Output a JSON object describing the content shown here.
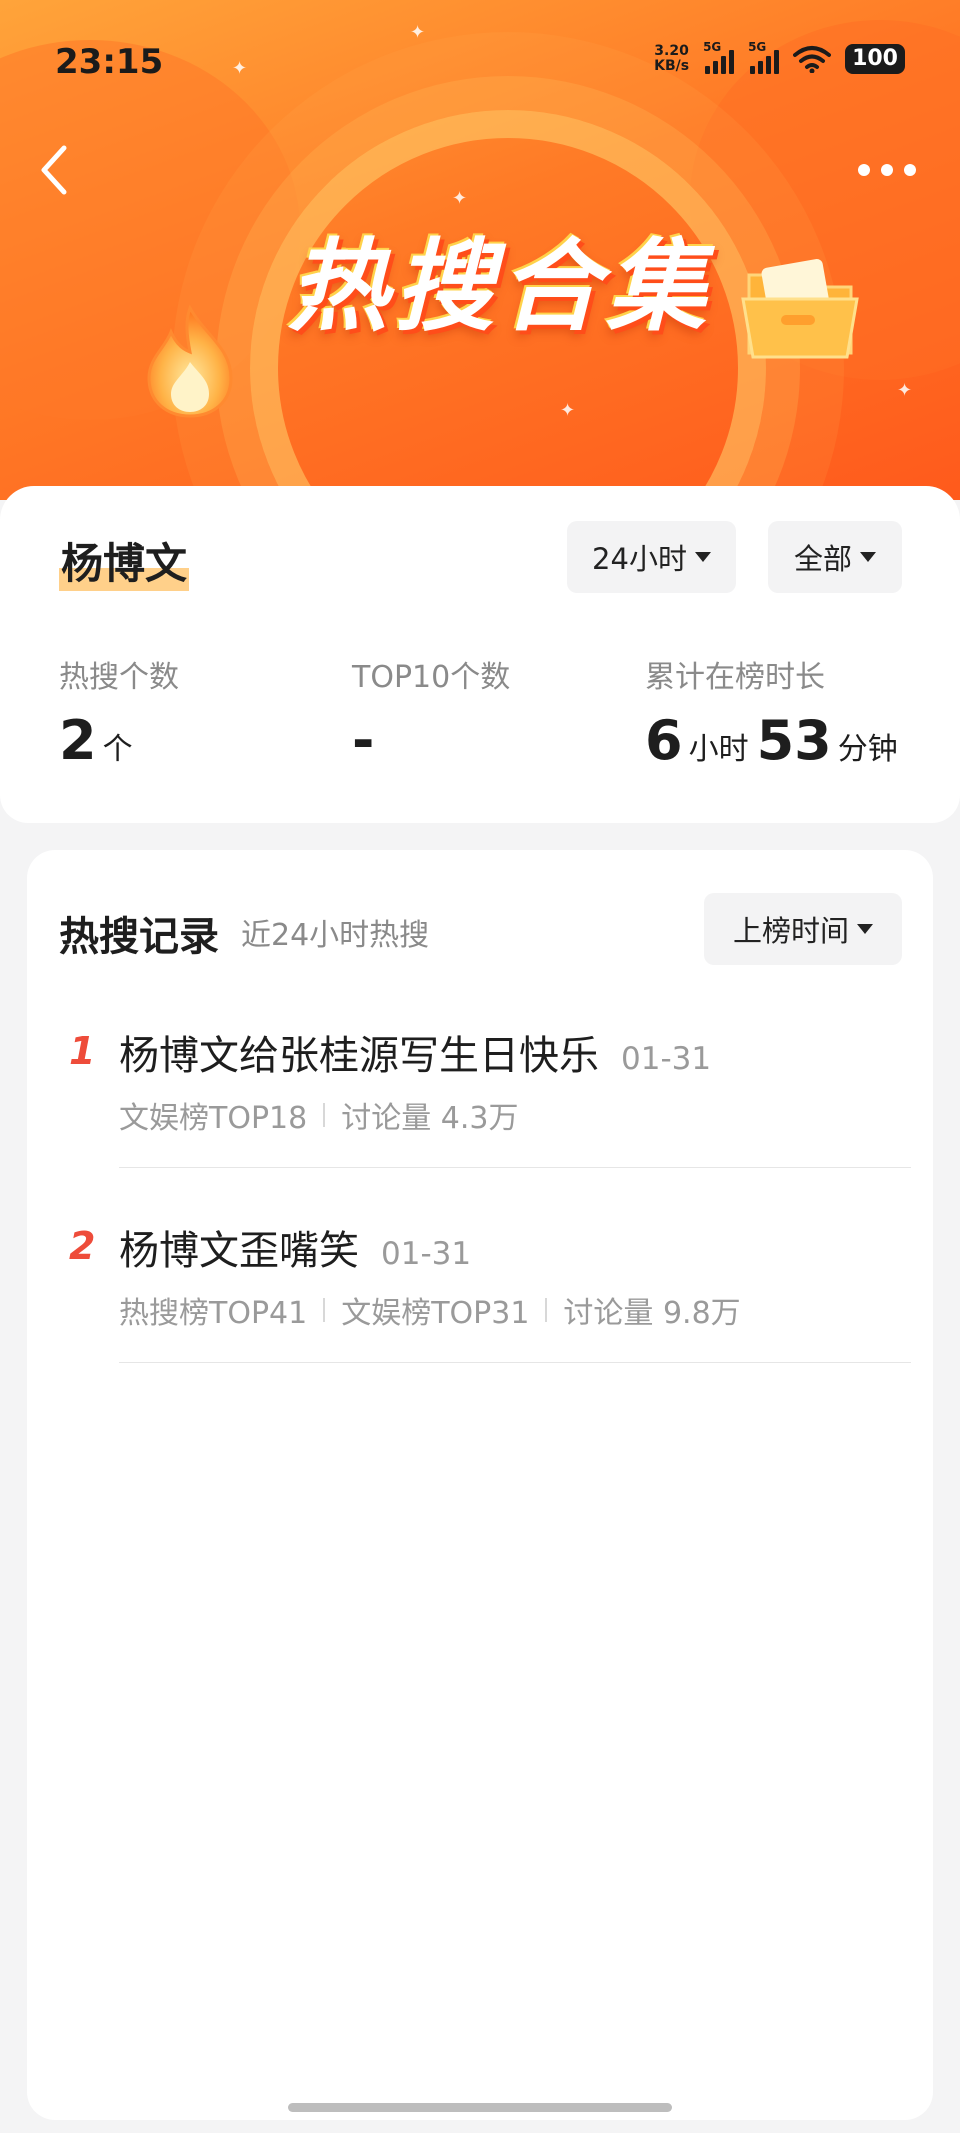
{
  "status_bar": {
    "time": "23:15",
    "net_speed_value": "3.20",
    "net_speed_unit": "KB/s",
    "signal_1": "5G",
    "signal_2": "5G",
    "battery": "100"
  },
  "header": {
    "banner_title": "热搜合集",
    "back_icon": "chevron-left-icon",
    "more_icon": "more-dots-icon"
  },
  "summary": {
    "name": "杨博文",
    "range_filter": "24小时",
    "scope_filter": "全部",
    "stats": [
      {
        "label": "热搜个数",
        "value": "2",
        "unit": "个"
      },
      {
        "label": "TOP10个数",
        "value": "-"
      },
      {
        "label": "累计在榜时长",
        "hours": "6",
        "hours_unit": "小时",
        "minutes": "53",
        "minutes_unit": "分钟"
      }
    ]
  },
  "records": {
    "title": "热搜记录",
    "subtitle": "近24小时热搜",
    "sort_filter": "上榜时间",
    "items": [
      {
        "rank": "1",
        "title": "杨博文给张桂源写生日快乐",
        "date": "01-31",
        "tags": [
          "文娱榜TOP18",
          "讨论量 4.3万"
        ]
      },
      {
        "rank": "2",
        "title": "杨博文歪嘴笑",
        "date": "01-31",
        "tags": [
          "热搜榜TOP41",
          "文娱榜TOP31",
          "讨论量 9.8万"
        ]
      }
    ]
  },
  "colors": {
    "accent": "#ff6a22",
    "rank": "#ee4c3a",
    "highlight": "#ffd08a"
  }
}
